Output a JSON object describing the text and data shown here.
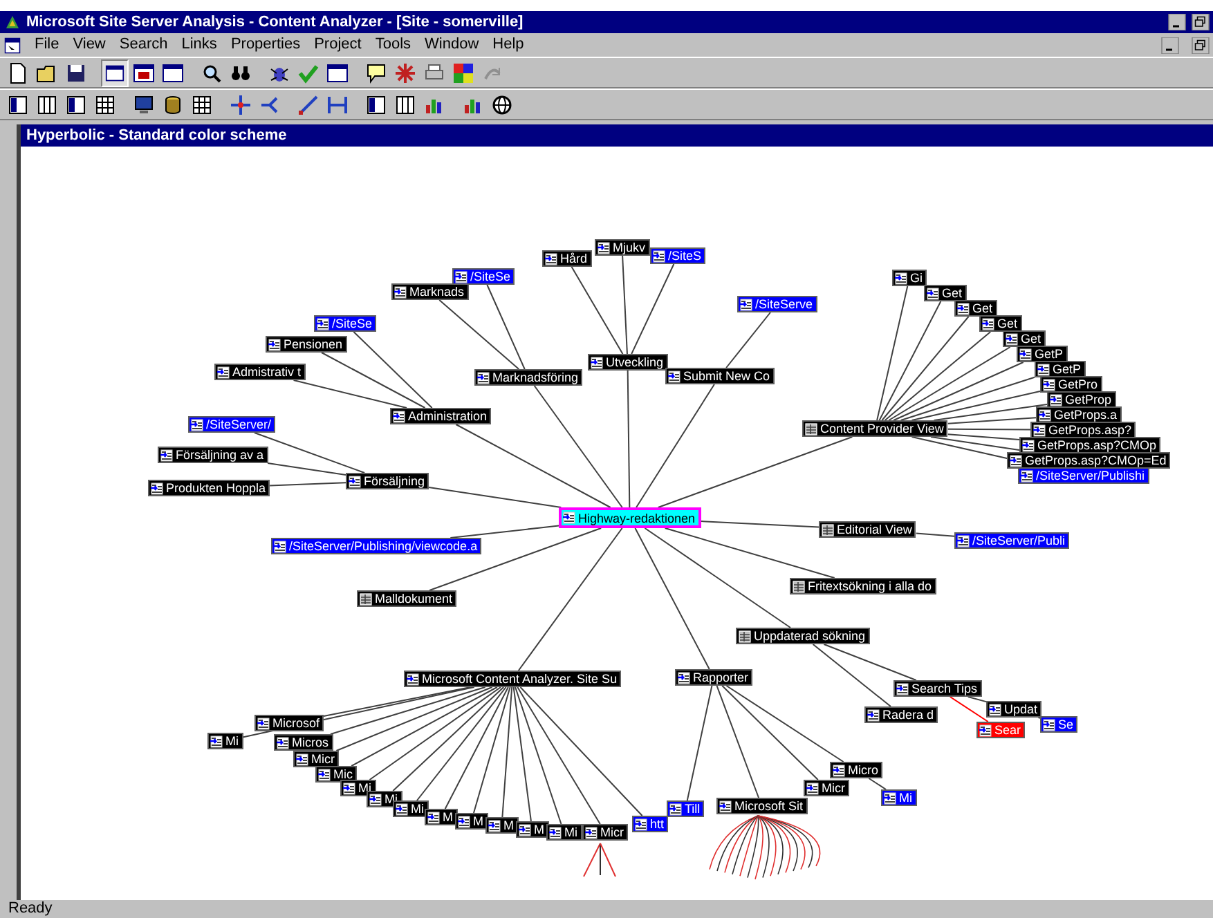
{
  "window": {
    "title": "Microsoft Site Server Analysis - Content Analyzer - [Site - somerville]"
  },
  "menu": [
    "File",
    "View",
    "Search",
    "Links",
    "Properties",
    "Project",
    "Tools",
    "Window",
    "Help"
  ],
  "view": {
    "title": "Hyperbolic - Standard color scheme"
  },
  "tree": {
    "label": "Highway-redaktionen",
    "kind": "page",
    "color": "#00ffff",
    "selected": true,
    "children": [
      {
        "label": "Försäljning",
        "kind": "page",
        "color": "#000000",
        "selected": false,
        "children": [
          {
            "label": "/SiteServer/",
            "kind": "page",
            "color": "#0000ff",
            "selected": false
          },
          {
            "label": "Försäljning av a",
            "kind": "page",
            "color": "#000000",
            "selected": false
          },
          {
            "label": "Produkten Hoppla",
            "kind": "page",
            "color": "#000000",
            "selected": false
          }
        ]
      },
      {
        "label": "Administration",
        "kind": "page",
        "color": "#000000",
        "selected": false,
        "children": [
          {
            "label": "/SiteSe",
            "kind": "page",
            "color": "#0000ff",
            "selected": false
          },
          {
            "label": "Pensionen",
            "kind": "page",
            "color": "#000000",
            "selected": false
          },
          {
            "label": "Admistrativ t",
            "kind": "page",
            "color": "#000000",
            "selected": false
          }
        ]
      },
      {
        "label": "Marknadsföring",
        "kind": "page",
        "color": "#000000",
        "selected": false,
        "children": [
          {
            "label": "Marknads",
            "kind": "page",
            "color": "#000000",
            "selected": false
          },
          {
            "label": "/SiteSe",
            "kind": "page",
            "color": "#0000ff",
            "selected": false
          }
        ]
      },
      {
        "label": "Utveckling",
        "kind": "page",
        "color": "#000000",
        "selected": false,
        "children": [
          {
            "label": "Hård",
            "kind": "page",
            "color": "#000000",
            "selected": false
          },
          {
            "label": "Mjukv",
            "kind": "page",
            "color": "#000000",
            "selected": false
          },
          {
            "label": "/SiteS",
            "kind": "page",
            "color": "#0000ff",
            "selected": false
          }
        ]
      },
      {
        "label": "Submit New Co",
        "kind": "page",
        "color": "#000000",
        "selected": false,
        "children": [
          {
            "label": "/SiteServe",
            "kind": "page",
            "color": "#0000ff",
            "selected": false
          }
        ]
      },
      {
        "label": "Content Provider View",
        "kind": "view",
        "color": "#000000",
        "selected": false,
        "children": [
          {
            "label": "Gi",
            "kind": "page",
            "color": "#000000",
            "selected": false
          },
          {
            "label": "Get",
            "kind": "page",
            "color": "#000000",
            "selected": false
          },
          {
            "label": "Get",
            "kind": "page",
            "color": "#000000",
            "selected": false
          },
          {
            "label": "Get",
            "kind": "page",
            "color": "#000000",
            "selected": false
          },
          {
            "label": "Get",
            "kind": "page",
            "color": "#000000",
            "selected": false
          },
          {
            "label": "GetP",
            "kind": "page",
            "color": "#000000",
            "selected": false
          },
          {
            "label": "GetP",
            "kind": "page",
            "color": "#000000",
            "selected": false
          },
          {
            "label": "GetPro",
            "kind": "page",
            "color": "#000000",
            "selected": false
          },
          {
            "label": "GetProp",
            "kind": "page",
            "color": "#000000",
            "selected": false
          },
          {
            "label": "GetProps.a",
            "kind": "page",
            "color": "#000000",
            "selected": false
          },
          {
            "label": "GetProps.asp?",
            "kind": "page",
            "color": "#000000",
            "selected": false
          },
          {
            "label": "GetProps.asp?CMOp",
            "kind": "page",
            "color": "#000000",
            "selected": false
          },
          {
            "label": "GetProps.asp?CMOp=Ed",
            "kind": "page",
            "color": "#000000",
            "selected": false
          },
          {
            "label": "/SiteServer/Publishi",
            "kind": "page",
            "color": "#0000ff",
            "selected": false
          }
        ]
      },
      {
        "label": "Editorial View",
        "kind": "view",
        "color": "#000000",
        "selected": false,
        "children": [
          {
            "label": "/SiteServer/Publi",
            "kind": "page",
            "color": "#0000ff",
            "selected": false
          }
        ]
      },
      {
        "label": "Fritextsökning i alla do",
        "kind": "view",
        "color": "#000000",
        "selected": false
      },
      {
        "label": "Uppdaterad sökning",
        "kind": "view",
        "color": "#000000",
        "selected": false,
        "children": [
          {
            "label": "Search Tips",
            "kind": "page",
            "color": "#000000",
            "selected": false,
            "children": [
              {
                "label": "Updat",
                "kind": "page",
                "color": "#000000",
                "selected": false,
                "children": [
                  {
                    "label": "Se",
                    "kind": "page",
                    "color": "#0000ff",
                    "selected": false
                  }
                ]
              },
              {
                "label": "Sear",
                "kind": "page",
                "color": "#ff0000",
                "selected": false
              }
            ]
          },
          {
            "label": "Radera d",
            "kind": "page",
            "color": "#000000",
            "selected": false
          }
        ]
      },
      {
        "label": "Rapporter",
        "kind": "page",
        "color": "#000000",
        "selected": false,
        "children": [
          {
            "label": "Till",
            "kind": "page",
            "color": "#0000ff",
            "selected": false
          },
          {
            "label": "Microsoft Sit",
            "kind": "page",
            "color": "#000000",
            "selected": false
          },
          {
            "label": "Micr",
            "kind": "page",
            "color": "#000000",
            "selected": false
          },
          {
            "label": "Micro",
            "kind": "page",
            "color": "#000000",
            "selected": false,
            "children": [
              {
                "label": "Mi",
                "kind": "page",
                "color": "#0000ff",
                "selected": false
              }
            ]
          }
        ]
      },
      {
        "label": "/SiteServer/Publishing/viewcode.a",
        "kind": "page",
        "color": "#0000ff",
        "selected": false
      },
      {
        "label": "Malldokument",
        "kind": "view",
        "color": "#000000",
        "selected": false
      },
      {
        "label": "Microsoft Content Analyzer. Site Su",
        "kind": "page",
        "color": "#000000",
        "selected": false,
        "children": [
          {
            "label": "Microsof",
            "kind": "page",
            "color": "#000000",
            "selected": false
          },
          {
            "label": "Mi",
            "kind": "page",
            "color": "#000000",
            "selected": false
          },
          {
            "label": "Micros",
            "kind": "page",
            "color": "#000000",
            "selected": false
          },
          {
            "label": "Micr",
            "kind": "page",
            "color": "#000000",
            "selected": false
          },
          {
            "label": "Mic",
            "kind": "page",
            "color": "#000000",
            "selected": false
          },
          {
            "label": "Mi",
            "kind": "page",
            "color": "#000000",
            "selected": false
          },
          {
            "label": "Mi",
            "kind": "page",
            "color": "#000000",
            "selected": false
          },
          {
            "label": "Mi",
            "kind": "page",
            "color": "#000000",
            "selected": false
          },
          {
            "label": "M",
            "kind": "page",
            "color": "#000000",
            "selected": false
          },
          {
            "label": "M",
            "kind": "page",
            "color": "#000000",
            "selected": false
          },
          {
            "label": "M",
            "kind": "page",
            "color": "#000000",
            "selected": false
          },
          {
            "label": "M",
            "kind": "page",
            "color": "#000000",
            "selected": false
          },
          {
            "label": "Mi",
            "kind": "page",
            "color": "#000000",
            "selected": false
          },
          {
            "label": "Micr",
            "kind": "page",
            "color": "#000000",
            "selected": false
          },
          {
            "label": "htt",
            "kind": "page",
            "color": "#0000ff",
            "selected": false
          }
        ]
      }
    ]
  },
  "status_bar": "Ready"
}
